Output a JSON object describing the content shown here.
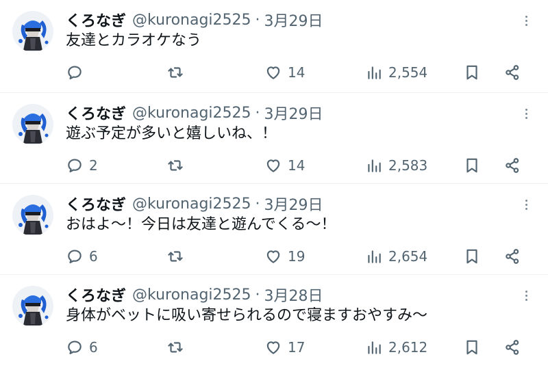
{
  "author": {
    "display_name": "くろなぎ",
    "handle": "@kuronagi2525",
    "separator": "·"
  },
  "icons": {
    "reply": "reply-icon",
    "retweet": "retweet-icon",
    "like": "heart-icon",
    "views": "views-chart-icon",
    "bookmark": "bookmark-icon",
    "share": "share-icon",
    "more": "more-dots-icon"
  },
  "colors": {
    "text": "#0f1419",
    "secondary": "#536471",
    "divider": "#eff3f4"
  },
  "tweets": [
    {
      "date": "3月29日",
      "text": "友達とカラオケなう",
      "replies": "",
      "retweets": "",
      "likes": "14",
      "views": "2,554"
    },
    {
      "date": "3月29日",
      "text": "遊ぶ予定が多いと嬉しいね、！",
      "replies": "2",
      "retweets": "",
      "likes": "14",
      "views": "2,583"
    },
    {
      "date": "3月29日",
      "text": "おはよ〜！今日は友達と遊んでくる〜！",
      "replies": "6",
      "retweets": "",
      "likes": "19",
      "views": "2,654"
    },
    {
      "date": "3月28日",
      "text": "身体がベットに吸い寄せられるので寝ますおやすみ〜",
      "replies": "6",
      "retweets": "",
      "likes": "17",
      "views": "2,612"
    }
  ]
}
